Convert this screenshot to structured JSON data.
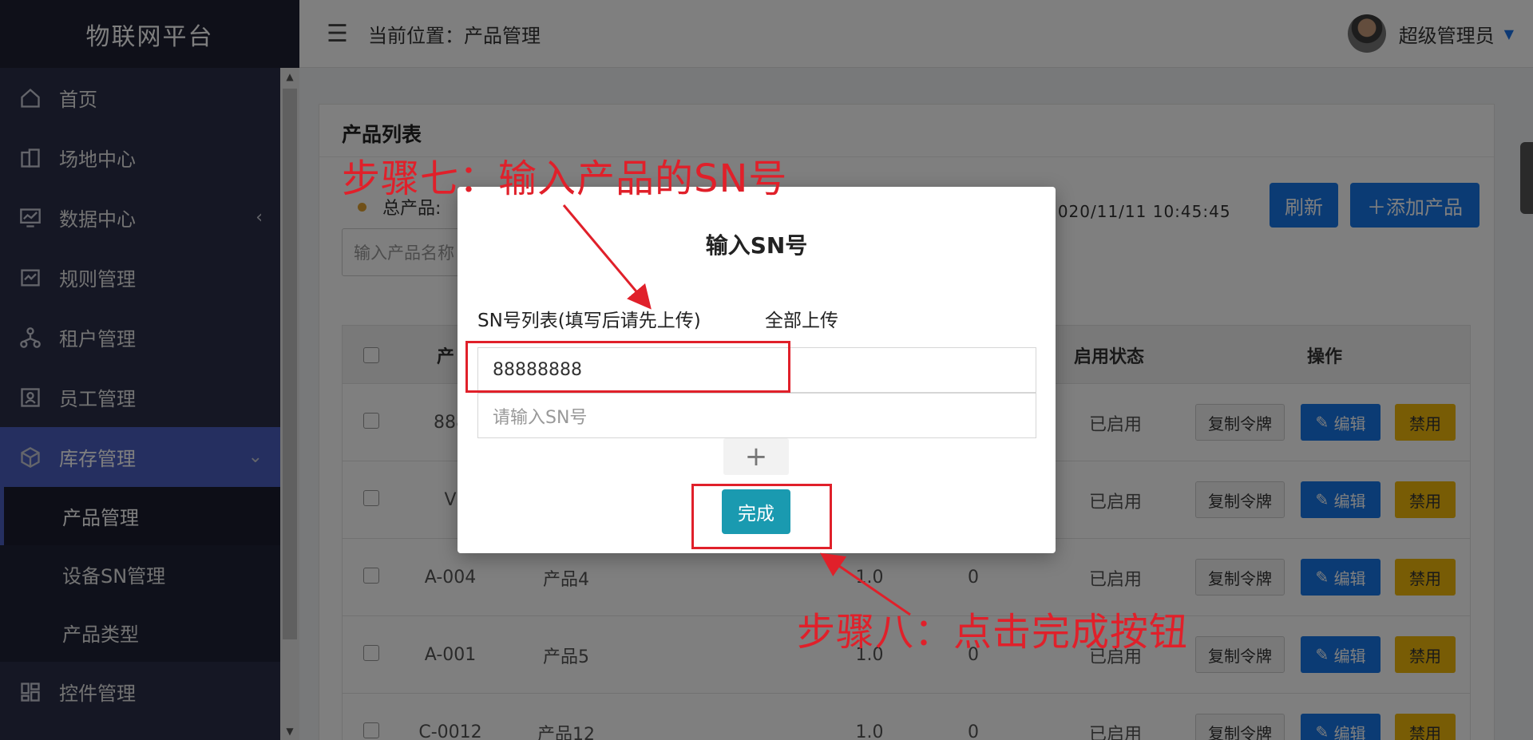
{
  "app": {
    "brand": "物联网平台"
  },
  "topbar": {
    "breadcrumb": "当前位置：产品管理",
    "user_name": "超级管理员"
  },
  "sidebar": {
    "items": [
      {
        "label": "首页",
        "icon": "home-icon"
      },
      {
        "label": "场地中心",
        "icon": "building-icon"
      },
      {
        "label": "数据中心",
        "icon": "monitor-chart-icon",
        "arrow": "‹"
      },
      {
        "label": "规则管理",
        "icon": "rules-icon"
      },
      {
        "label": "租户管理",
        "icon": "tenant-icon"
      },
      {
        "label": "员工管理",
        "icon": "staff-icon"
      },
      {
        "label": "库存管理",
        "icon": "box-icon",
        "arrow": "⌄"
      },
      {
        "label": "控件管理",
        "icon": "widgets-icon"
      }
    ],
    "submenu": [
      "产品管理",
      "设备SN管理",
      "产品类型"
    ]
  },
  "card": {
    "title": "产品列表",
    "stat_label": "总产品:",
    "refresh_time": "新: 2020/11/11 10:45:45",
    "refresh_label": "刷新",
    "add_label": "＋添加产品",
    "search_placeholder": "输入产品名称"
  },
  "table": {
    "headers": {
      "product": "产",
      "status": "启用状态",
      "actions": "操作"
    },
    "rows": [
      {
        "code": "888",
        "name": "",
        "version": "",
        "count": "",
        "status": "已启用"
      },
      {
        "code": "V",
        "name": "",
        "version": "",
        "count": "",
        "status": "已启用"
      },
      {
        "code": "A-004",
        "name": "产品4",
        "version": "1.0",
        "count": "0",
        "status": "已启用"
      },
      {
        "code": "A-001",
        "name": "产品5",
        "version": "1.0",
        "count": "0",
        "status": "已启用"
      },
      {
        "code": "C-0012",
        "name": "产品12",
        "version": "1.0",
        "count": "0",
        "status": "已启用"
      }
    ],
    "actions": {
      "copy": "复制令牌",
      "edit": "编辑",
      "disable": "禁用"
    }
  },
  "modal": {
    "title": "输入SN号",
    "list_label": "SN号列表(填写后请先上传)",
    "upload_all": "全部上传",
    "sn_value": "88888888",
    "sn_placeholder": "请输入SN号",
    "plus": "+",
    "done": "完成"
  },
  "annotations": {
    "step7": "步骤七：输入产品的SN号",
    "step8": "步骤八：点击完成按钮",
    "color": "#e0202a"
  }
}
